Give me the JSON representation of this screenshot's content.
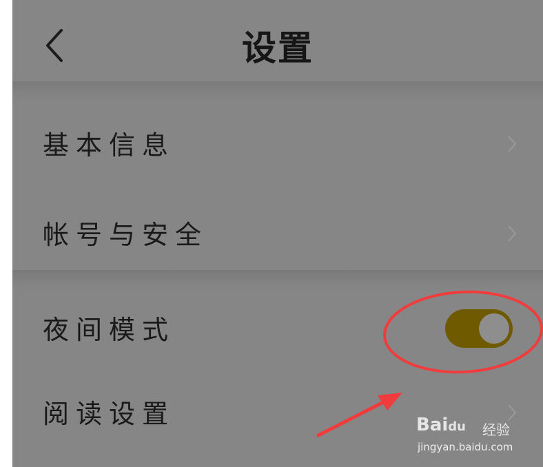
{
  "header": {
    "title": "设置",
    "back_icon": "chevron-left-icon"
  },
  "settings": {
    "items": [
      {
        "label": "基本信息",
        "trailing": "chevron-right-icon"
      },
      {
        "label": "帐号与安全",
        "trailing": "chevron-right-icon"
      },
      {
        "label": "夜间模式",
        "trailing": "toggle",
        "toggle_on": true
      },
      {
        "label": "阅读设置",
        "trailing": "chevron-right-icon"
      }
    ]
  },
  "annotation": {
    "circle_color": "#f03c3c",
    "arrow_color": "#f03c3c"
  },
  "watermark": {
    "brand": "Bai",
    "paw": "du",
    "suffix": "经验",
    "url": "jingyan.baidu.com"
  },
  "colors": {
    "background": "#868686",
    "toggle_on": "#6f5a00",
    "text": "#1a1a1a"
  }
}
